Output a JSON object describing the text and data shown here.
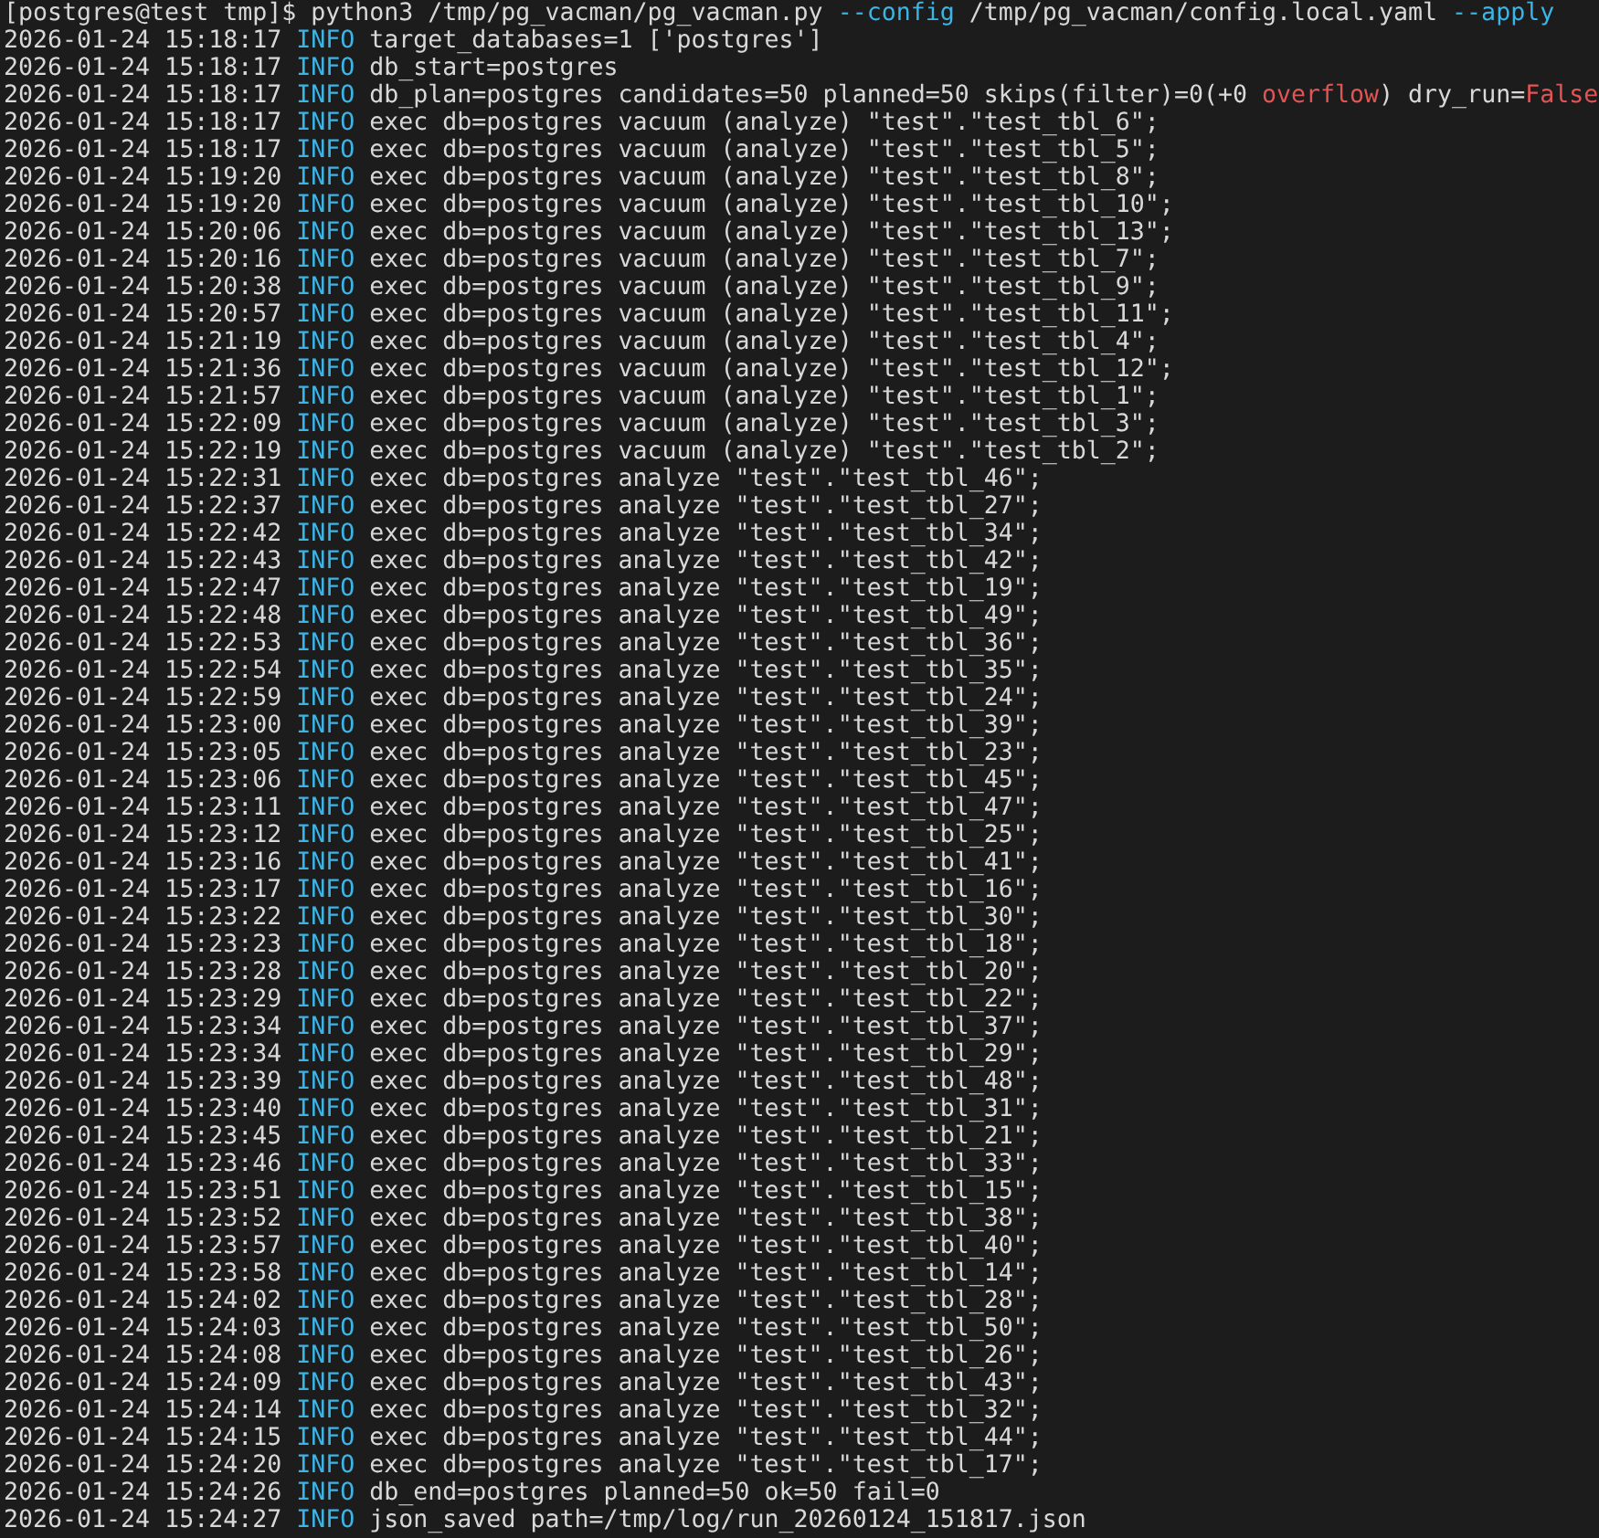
{
  "terminal": {
    "prompt": "[postgres@test tmp]$",
    "command": [
      {
        "text": "python3 /tmp/pg_vacman/pg_vacman.py ",
        "kind": "plain"
      },
      {
        "text": "--config",
        "kind": "option"
      },
      {
        "text": " /tmp/pg_vacman/config.local.yaml ",
        "kind": "plain"
      },
      {
        "text": "--apply",
        "kind": "option"
      }
    ],
    "lines": [
      {
        "timestamp": "2026-01-24 15:18:17",
        "level": "INFO",
        "message": [
          {
            "text": "target_databases=1 ['postgres']",
            "kind": "plain"
          }
        ]
      },
      {
        "timestamp": "2026-01-24 15:18:17",
        "level": "INFO",
        "message": [
          {
            "text": "db_start=postgres",
            "kind": "plain"
          }
        ]
      },
      {
        "timestamp": "2026-01-24 15:18:17",
        "level": "INFO",
        "message": [
          {
            "text": "db_plan=postgres candidates=50 planned=50 skips(filter)=0(+0 ",
            "kind": "plain"
          },
          {
            "text": "overflow",
            "kind": "warn"
          },
          {
            "text": ") dry_run=",
            "kind": "plain"
          },
          {
            "text": "False",
            "kind": "warn"
          }
        ]
      },
      {
        "timestamp": "2026-01-24 15:18:17",
        "level": "INFO",
        "message": [
          {
            "text": "exec db=postgres vacuum (analyze) \"test\".\"test_tbl_6\";",
            "kind": "plain"
          }
        ]
      },
      {
        "timestamp": "2026-01-24 15:18:17",
        "level": "INFO",
        "message": [
          {
            "text": "exec db=postgres vacuum (analyze) \"test\".\"test_tbl_5\";",
            "kind": "plain"
          }
        ]
      },
      {
        "timestamp": "2026-01-24 15:19:20",
        "level": "INFO",
        "message": [
          {
            "text": "exec db=postgres vacuum (analyze) \"test\".\"test_tbl_8\";",
            "kind": "plain"
          }
        ]
      },
      {
        "timestamp": "2026-01-24 15:19:20",
        "level": "INFO",
        "message": [
          {
            "text": "exec db=postgres vacuum (analyze) \"test\".\"test_tbl_10\";",
            "kind": "plain"
          }
        ]
      },
      {
        "timestamp": "2026-01-24 15:20:06",
        "level": "INFO",
        "message": [
          {
            "text": "exec db=postgres vacuum (analyze) \"test\".\"test_tbl_13\";",
            "kind": "plain"
          }
        ]
      },
      {
        "timestamp": "2026-01-24 15:20:16",
        "level": "INFO",
        "message": [
          {
            "text": "exec db=postgres vacuum (analyze) \"test\".\"test_tbl_7\";",
            "kind": "plain"
          }
        ]
      },
      {
        "timestamp": "2026-01-24 15:20:38",
        "level": "INFO",
        "message": [
          {
            "text": "exec db=postgres vacuum (analyze) \"test\".\"test_tbl_9\";",
            "kind": "plain"
          }
        ]
      },
      {
        "timestamp": "2026-01-24 15:20:57",
        "level": "INFO",
        "message": [
          {
            "text": "exec db=postgres vacuum (analyze) \"test\".\"test_tbl_11\";",
            "kind": "plain"
          }
        ]
      },
      {
        "timestamp": "2026-01-24 15:21:19",
        "level": "INFO",
        "message": [
          {
            "text": "exec db=postgres vacuum (analyze) \"test\".\"test_tbl_4\";",
            "kind": "plain"
          }
        ]
      },
      {
        "timestamp": "2026-01-24 15:21:36",
        "level": "INFO",
        "message": [
          {
            "text": "exec db=postgres vacuum (analyze) \"test\".\"test_tbl_12\";",
            "kind": "plain"
          }
        ]
      },
      {
        "timestamp": "2026-01-24 15:21:57",
        "level": "INFO",
        "message": [
          {
            "text": "exec db=postgres vacuum (analyze) \"test\".\"test_tbl_1\";",
            "kind": "plain"
          }
        ]
      },
      {
        "timestamp": "2026-01-24 15:22:09",
        "level": "INFO",
        "message": [
          {
            "text": "exec db=postgres vacuum (analyze) \"test\".\"test_tbl_3\";",
            "kind": "plain"
          }
        ]
      },
      {
        "timestamp": "2026-01-24 15:22:19",
        "level": "INFO",
        "message": [
          {
            "text": "exec db=postgres vacuum (analyze) \"test\".\"test_tbl_2\";",
            "kind": "plain"
          }
        ]
      },
      {
        "timestamp": "2026-01-24 15:22:31",
        "level": "INFO",
        "message": [
          {
            "text": "exec db=postgres analyze \"test\".\"test_tbl_46\";",
            "kind": "plain"
          }
        ]
      },
      {
        "timestamp": "2026-01-24 15:22:37",
        "level": "INFO",
        "message": [
          {
            "text": "exec db=postgres analyze \"test\".\"test_tbl_27\";",
            "kind": "plain"
          }
        ]
      },
      {
        "timestamp": "2026-01-24 15:22:42",
        "level": "INFO",
        "message": [
          {
            "text": "exec db=postgres analyze \"test\".\"test_tbl_34\";",
            "kind": "plain"
          }
        ]
      },
      {
        "timestamp": "2026-01-24 15:22:43",
        "level": "INFO",
        "message": [
          {
            "text": "exec db=postgres analyze \"test\".\"test_tbl_42\";",
            "kind": "plain"
          }
        ]
      },
      {
        "timestamp": "2026-01-24 15:22:47",
        "level": "INFO",
        "message": [
          {
            "text": "exec db=postgres analyze \"test\".\"test_tbl_19\";",
            "kind": "plain"
          }
        ]
      },
      {
        "timestamp": "2026-01-24 15:22:48",
        "level": "INFO",
        "message": [
          {
            "text": "exec db=postgres analyze \"test\".\"test_tbl_49\";",
            "kind": "plain"
          }
        ]
      },
      {
        "timestamp": "2026-01-24 15:22:53",
        "level": "INFO",
        "message": [
          {
            "text": "exec db=postgres analyze \"test\".\"test_tbl_36\";",
            "kind": "plain"
          }
        ]
      },
      {
        "timestamp": "2026-01-24 15:22:54",
        "level": "INFO",
        "message": [
          {
            "text": "exec db=postgres analyze \"test\".\"test_tbl_35\";",
            "kind": "plain"
          }
        ]
      },
      {
        "timestamp": "2026-01-24 15:22:59",
        "level": "INFO",
        "message": [
          {
            "text": "exec db=postgres analyze \"test\".\"test_tbl_24\";",
            "kind": "plain"
          }
        ]
      },
      {
        "timestamp": "2026-01-24 15:23:00",
        "level": "INFO",
        "message": [
          {
            "text": "exec db=postgres analyze \"test\".\"test_tbl_39\";",
            "kind": "plain"
          }
        ]
      },
      {
        "timestamp": "2026-01-24 15:23:05",
        "level": "INFO",
        "message": [
          {
            "text": "exec db=postgres analyze \"test\".\"test_tbl_23\";",
            "kind": "plain"
          }
        ]
      },
      {
        "timestamp": "2026-01-24 15:23:06",
        "level": "INFO",
        "message": [
          {
            "text": "exec db=postgres analyze \"test\".\"test_tbl_45\";",
            "kind": "plain"
          }
        ]
      },
      {
        "timestamp": "2026-01-24 15:23:11",
        "level": "INFO",
        "message": [
          {
            "text": "exec db=postgres analyze \"test\".\"test_tbl_47\";",
            "kind": "plain"
          }
        ]
      },
      {
        "timestamp": "2026-01-24 15:23:12",
        "level": "INFO",
        "message": [
          {
            "text": "exec db=postgres analyze \"test\".\"test_tbl_25\";",
            "kind": "plain"
          }
        ]
      },
      {
        "timestamp": "2026-01-24 15:23:16",
        "level": "INFO",
        "message": [
          {
            "text": "exec db=postgres analyze \"test\".\"test_tbl_41\";",
            "kind": "plain"
          }
        ]
      },
      {
        "timestamp": "2026-01-24 15:23:17",
        "level": "INFO",
        "message": [
          {
            "text": "exec db=postgres analyze \"test\".\"test_tbl_16\";",
            "kind": "plain"
          }
        ]
      },
      {
        "timestamp": "2026-01-24 15:23:22",
        "level": "INFO",
        "message": [
          {
            "text": "exec db=postgres analyze \"test\".\"test_tbl_30\";",
            "kind": "plain"
          }
        ]
      },
      {
        "timestamp": "2026-01-24 15:23:23",
        "level": "INFO",
        "message": [
          {
            "text": "exec db=postgres analyze \"test\".\"test_tbl_18\";",
            "kind": "plain"
          }
        ]
      },
      {
        "timestamp": "2026-01-24 15:23:28",
        "level": "INFO",
        "message": [
          {
            "text": "exec db=postgres analyze \"test\".\"test_tbl_20\";",
            "kind": "plain"
          }
        ]
      },
      {
        "timestamp": "2026-01-24 15:23:29",
        "level": "INFO",
        "message": [
          {
            "text": "exec db=postgres analyze \"test\".\"test_tbl_22\";",
            "kind": "plain"
          }
        ]
      },
      {
        "timestamp": "2026-01-24 15:23:34",
        "level": "INFO",
        "message": [
          {
            "text": "exec db=postgres analyze \"test\".\"test_tbl_37\";",
            "kind": "plain"
          }
        ]
      },
      {
        "timestamp": "2026-01-24 15:23:34",
        "level": "INFO",
        "message": [
          {
            "text": "exec db=postgres analyze \"test\".\"test_tbl_29\";",
            "kind": "plain"
          }
        ]
      },
      {
        "timestamp": "2026-01-24 15:23:39",
        "level": "INFO",
        "message": [
          {
            "text": "exec db=postgres analyze \"test\".\"test_tbl_48\";",
            "kind": "plain"
          }
        ]
      },
      {
        "timestamp": "2026-01-24 15:23:40",
        "level": "INFO",
        "message": [
          {
            "text": "exec db=postgres analyze \"test\".\"test_tbl_31\";",
            "kind": "plain"
          }
        ]
      },
      {
        "timestamp": "2026-01-24 15:23:45",
        "level": "INFO",
        "message": [
          {
            "text": "exec db=postgres analyze \"test\".\"test_tbl_21\";",
            "kind": "plain"
          }
        ]
      },
      {
        "timestamp": "2026-01-24 15:23:46",
        "level": "INFO",
        "message": [
          {
            "text": "exec db=postgres analyze \"test\".\"test_tbl_33\";",
            "kind": "plain"
          }
        ]
      },
      {
        "timestamp": "2026-01-24 15:23:51",
        "level": "INFO",
        "message": [
          {
            "text": "exec db=postgres analyze \"test\".\"test_tbl_15\";",
            "kind": "plain"
          }
        ]
      },
      {
        "timestamp": "2026-01-24 15:23:52",
        "level": "INFO",
        "message": [
          {
            "text": "exec db=postgres analyze \"test\".\"test_tbl_38\";",
            "kind": "plain"
          }
        ]
      },
      {
        "timestamp": "2026-01-24 15:23:57",
        "level": "INFO",
        "message": [
          {
            "text": "exec db=postgres analyze \"test\".\"test_tbl_40\";",
            "kind": "plain"
          }
        ]
      },
      {
        "timestamp": "2026-01-24 15:23:58",
        "level": "INFO",
        "message": [
          {
            "text": "exec db=postgres analyze \"test\".\"test_tbl_14\";",
            "kind": "plain"
          }
        ]
      },
      {
        "timestamp": "2026-01-24 15:24:02",
        "level": "INFO",
        "message": [
          {
            "text": "exec db=postgres analyze \"test\".\"test_tbl_28\";",
            "kind": "plain"
          }
        ]
      },
      {
        "timestamp": "2026-01-24 15:24:03",
        "level": "INFO",
        "message": [
          {
            "text": "exec db=postgres analyze \"test\".\"test_tbl_50\";",
            "kind": "plain"
          }
        ]
      },
      {
        "timestamp": "2026-01-24 15:24:08",
        "level": "INFO",
        "message": [
          {
            "text": "exec db=postgres analyze \"test\".\"test_tbl_26\";",
            "kind": "plain"
          }
        ]
      },
      {
        "timestamp": "2026-01-24 15:24:09",
        "level": "INFO",
        "message": [
          {
            "text": "exec db=postgres analyze \"test\".\"test_tbl_43\";",
            "kind": "plain"
          }
        ]
      },
      {
        "timestamp": "2026-01-24 15:24:14",
        "level": "INFO",
        "message": [
          {
            "text": "exec db=postgres analyze \"test\".\"test_tbl_32\";",
            "kind": "plain"
          }
        ]
      },
      {
        "timestamp": "2026-01-24 15:24:15",
        "level": "INFO",
        "message": [
          {
            "text": "exec db=postgres analyze \"test\".\"test_tbl_44\";",
            "kind": "plain"
          }
        ]
      },
      {
        "timestamp": "2026-01-24 15:24:20",
        "level": "INFO",
        "message": [
          {
            "text": "exec db=postgres analyze \"test\".\"test_tbl_17\";",
            "kind": "plain"
          }
        ]
      },
      {
        "timestamp": "2026-01-24 15:24:26",
        "level": "INFO",
        "message": [
          {
            "text": "db_end=postgres planned=50 ok=50 fail=0",
            "kind": "plain"
          }
        ]
      },
      {
        "timestamp": "2026-01-24 15:24:27",
        "level": "INFO",
        "message": [
          {
            "text": "json_saved path=/tmp/log/run_20260124_151817.json",
            "kind": "plain"
          }
        ]
      }
    ]
  }
}
